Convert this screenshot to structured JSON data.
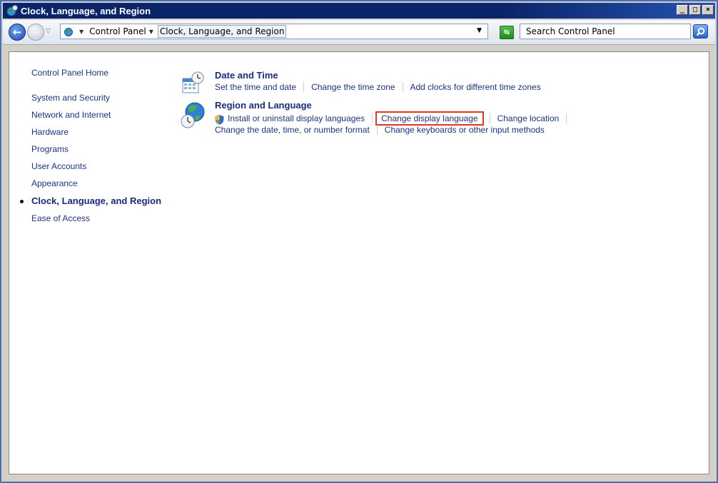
{
  "window": {
    "title": "Clock, Language, and Region",
    "buttons": {
      "minimize": "_",
      "maximize": "□",
      "close": "×"
    }
  },
  "address_bar": {
    "back_icon": "back-arrow-icon",
    "forward_icon": "forward-arrow-icon",
    "crumbs": [
      "Control Panel",
      "Clock, Language, and Region"
    ],
    "search_placeholder": "Search Control Panel"
  },
  "sidebar": {
    "home": "Control Panel Home",
    "items": [
      {
        "label": "System and Security",
        "active": false
      },
      {
        "label": "Network and Internet",
        "active": false
      },
      {
        "label": "Hardware",
        "active": false
      },
      {
        "label": "Programs",
        "active": false
      },
      {
        "label": "User Accounts",
        "active": false
      },
      {
        "label": "Appearance",
        "active": false
      },
      {
        "label": "Clock, Language, and Region",
        "active": true
      },
      {
        "label": "Ease of Access",
        "active": false
      }
    ]
  },
  "categories": [
    {
      "title": "Date and Time",
      "icon": "calendar-clock-icon",
      "tasks": [
        "Set the time and date",
        "Change the time zone",
        "Add clocks for different time zones"
      ]
    },
    {
      "title": "Region and Language",
      "icon": "globe-clock-icon",
      "tasks_row1": [
        "Install or uninstall display languages",
        "Change display language",
        "Change location"
      ],
      "tasks_row2": [
        "Change the date, time, or number format",
        "Change keyboards or other input methods"
      ]
    }
  ],
  "colors": {
    "link": "#1e3287",
    "highlight": "#d93a1e",
    "titlebar": "#0a246a"
  }
}
